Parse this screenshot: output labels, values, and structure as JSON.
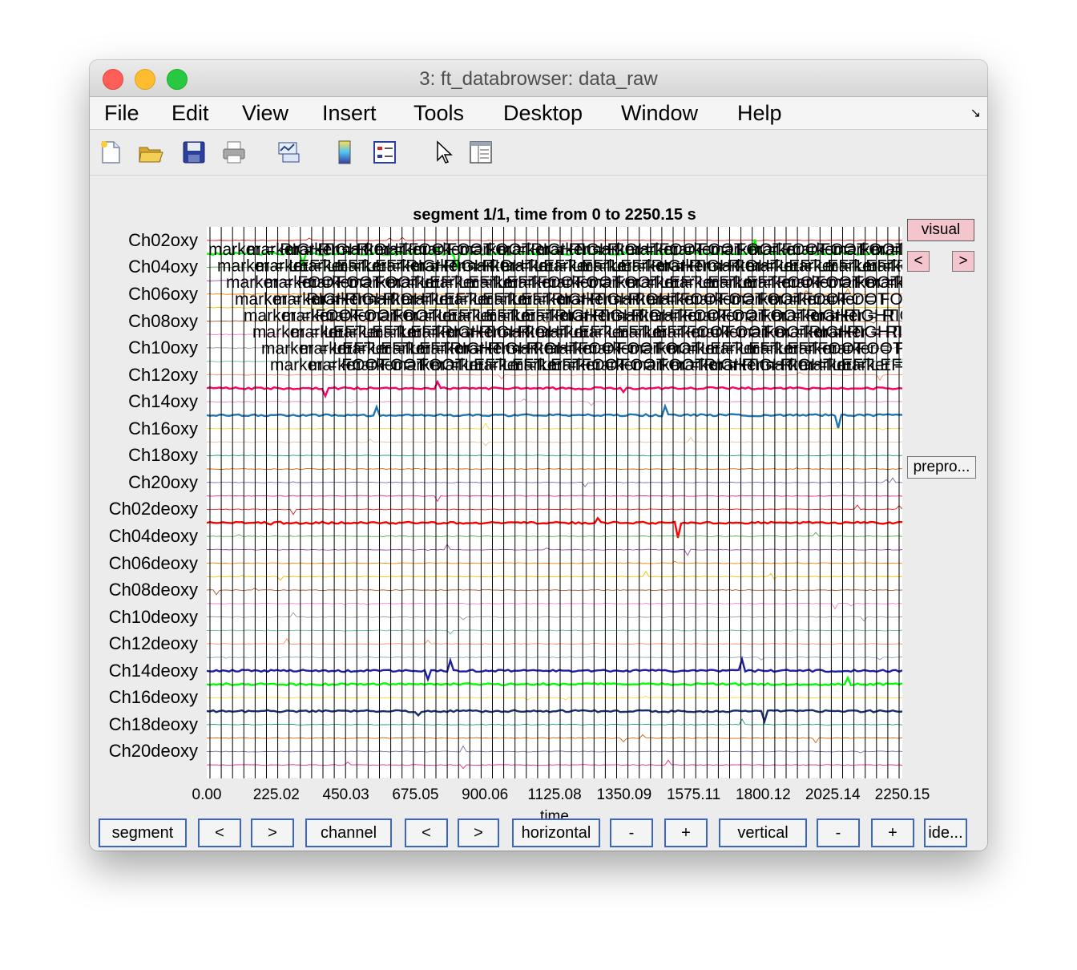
{
  "window": {
    "title": "3: ft_databrowser: data_raw"
  },
  "menu": [
    "File",
    "Edit",
    "View",
    "Insert",
    "Tools",
    "Desktop",
    "Window",
    "Help"
  ],
  "toolbar_icons": [
    "new-figure-icon",
    "open-file-icon",
    "save-icon",
    "print-icon",
    "link-plot-icon",
    "colorbar-icon",
    "legend-icon",
    "pointer-icon",
    "property-editor-icon"
  ],
  "plot": {
    "title": "segment 1/1, time from 0 to 2250.15 s",
    "xlabel": "time"
  },
  "side_buttons": {
    "visual": "visual",
    "prev": "<",
    "next": ">",
    "prepro": "prepro..."
  },
  "bottom_buttons": {
    "segment": "segment",
    "segment_prev": "<",
    "segment_next": ">",
    "channel": "channel",
    "channel_prev": "<",
    "channel_next": ">",
    "horizontal": "horizontal",
    "horizontal_minus": "-",
    "horizontal_plus": "+",
    "vertical": "vertical",
    "vertical_minus": "-",
    "vertical_plus": "+",
    "ide": "ide..."
  },
  "chart_data": {
    "type": "line",
    "title": "segment 1/1, time from 0 to 2250.15 s",
    "xlabel": "time",
    "ylabel": "",
    "xlim": [
      0,
      2250.15
    ],
    "xticks": [
      "0.00",
      "225.02",
      "450.03",
      "675.05",
      "900.06",
      "1125.08",
      "1350.09",
      "1575.11",
      "1800.12",
      "2025.14",
      "2250.15"
    ],
    "channel_labels": [
      "Ch02oxy",
      "Ch04oxy",
      "Ch06oxy",
      "Ch08oxy",
      "Ch10oxy",
      "Ch12oxy",
      "Ch14oxy",
      "Ch16oxy",
      "Ch18oxy",
      "Ch20oxy",
      "Ch02deoxy",
      "Ch04deoxy",
      "Ch06deoxy",
      "Ch08deoxy",
      "Ch10deoxy",
      "Ch12deoxy",
      "Ch14deoxy",
      "Ch16deoxy",
      "Ch18deoxy",
      "Ch20deoxy"
    ],
    "n_channels_plotted": 40,
    "channel_colors": [
      "#e41a1c",
      "#377eb8",
      "#4daf4a",
      "#984ea3",
      "#ff7f00",
      "#f0c000",
      "#a65628",
      "#f781bf",
      "#999999",
      "#66c2a5",
      "#fc8d62",
      "#8da0cb",
      "#e78ac3",
      "#a6d854",
      "#ffd92f",
      "#e5c494",
      "#1b9e77",
      "#d95f02",
      "#7570b3",
      "#e7298a"
    ],
    "highlighted_channels": [
      {
        "index": 1,
        "color": "#00ff00"
      },
      {
        "index": 11,
        "color": "#ff0066"
      },
      {
        "index": 13,
        "color": "#1f77b4"
      },
      {
        "index": 21,
        "color": "#ff0000"
      },
      {
        "index": 32,
        "color": "#1e1eaa"
      },
      {
        "index": 33,
        "color": "#00ff00"
      },
      {
        "index": 35,
        "color": "#1a2e6e"
      }
    ],
    "marker_rows": [
      "marker = RIGHT marker = FOOT marker = RIGHT marker = FOOT marker = FOOT marker = LEFT",
      "marker = LEFT marker = RIGHT marker = LEFT marker = RIGHT marker = LEFT marker = RIGHT",
      "marker = FOOT marker = LEFT marker = FOOT marker = LEFT marker = FOOT marker = F",
      "marker = RIGHT marker = LEFT marker = RIGHT marker = FOOT marker = FOOT",
      "marker = FOOT marker = LEFT marker = RIGHT marker = FOOT marker = RIGHT",
      "marker = LEFT marker = RIGHT marker = LEFT marker = FOOT marker = RIGHT",
      "marker = LEFT marker = RIGHT marker = FOOT marker = LEFT marker = FOOT",
      "marker = FOOT marker = LEFT marker = FOOT marker = RIGHT marker = LEFT"
    ],
    "legend": "none",
    "grid": false
  }
}
